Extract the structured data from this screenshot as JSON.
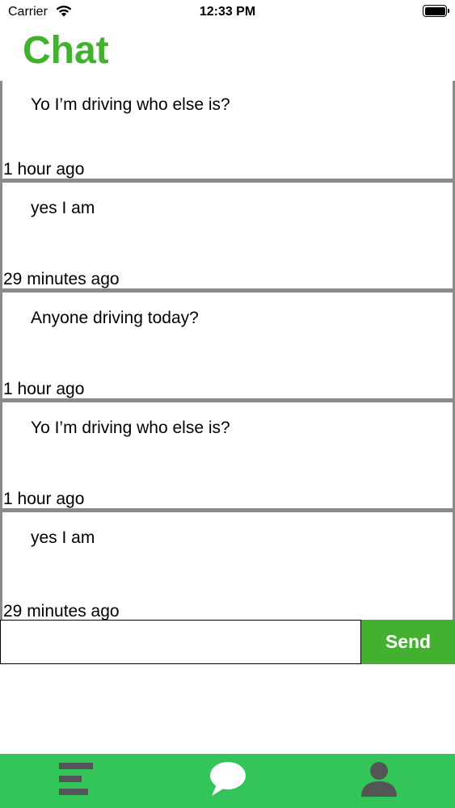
{
  "status_bar": {
    "carrier": "Carrier",
    "time": "12:33 PM",
    "wifi_icon": "wifi-icon",
    "battery_icon": "battery-icon"
  },
  "header": {
    "title": "Chat",
    "title_color": "#44b030"
  },
  "messages": [
    {
      "text": "Yo I’m driving who else is?",
      "time": "1 hour ago"
    },
    {
      "text": "yes I am",
      "time": "29 minutes ago"
    },
    {
      "text": "Anyone driving today?",
      "time": "1 hour ago"
    },
    {
      "text": "Yo I’m driving who else is?",
      "time": "1 hour ago"
    },
    {
      "text": "yes I am",
      "time": "29 minutes ago"
    }
  ],
  "composer": {
    "value": "",
    "placeholder": "",
    "send_label": "Send",
    "send_color": "#44b030"
  },
  "tab_bar": {
    "color": "#33c45a",
    "icon_color": "#555555",
    "tabs": [
      {
        "icon": "feed-icon"
      },
      {
        "icon": "chat-bubble-icon"
      },
      {
        "icon": "profile-icon"
      }
    ]
  }
}
